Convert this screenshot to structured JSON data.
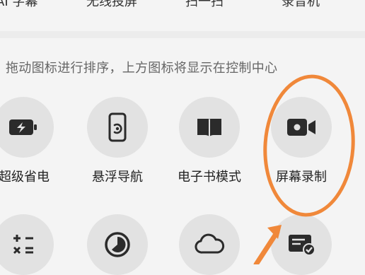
{
  "top_row": {
    "labels": [
      "AI 字幕",
      "无线投屏",
      "扫一扫",
      "录音机"
    ]
  },
  "hint": "拖动图标进行排序，上方图标将显示在控制中心",
  "tiles": [
    {
      "label": "超级省电",
      "icon": "battery-saver-icon"
    },
    {
      "label": "悬浮导航",
      "icon": "floating-navigation-icon"
    },
    {
      "label": "电子书模式",
      "icon": "ebook-icon"
    },
    {
      "label": "屏幕录制",
      "icon": "screen-record-icon"
    },
    {
      "label": "",
      "icon": "calculator-icon"
    },
    {
      "label": "",
      "icon": "timer-icon"
    },
    {
      "label": "",
      "icon": "cloud-icon"
    },
    {
      "label": "",
      "icon": "card-check-icon"
    }
  ],
  "colors": {
    "tile_bg": "#e2e2e2",
    "icon": "#2b2b2b",
    "annotation": "#f0883a"
  }
}
